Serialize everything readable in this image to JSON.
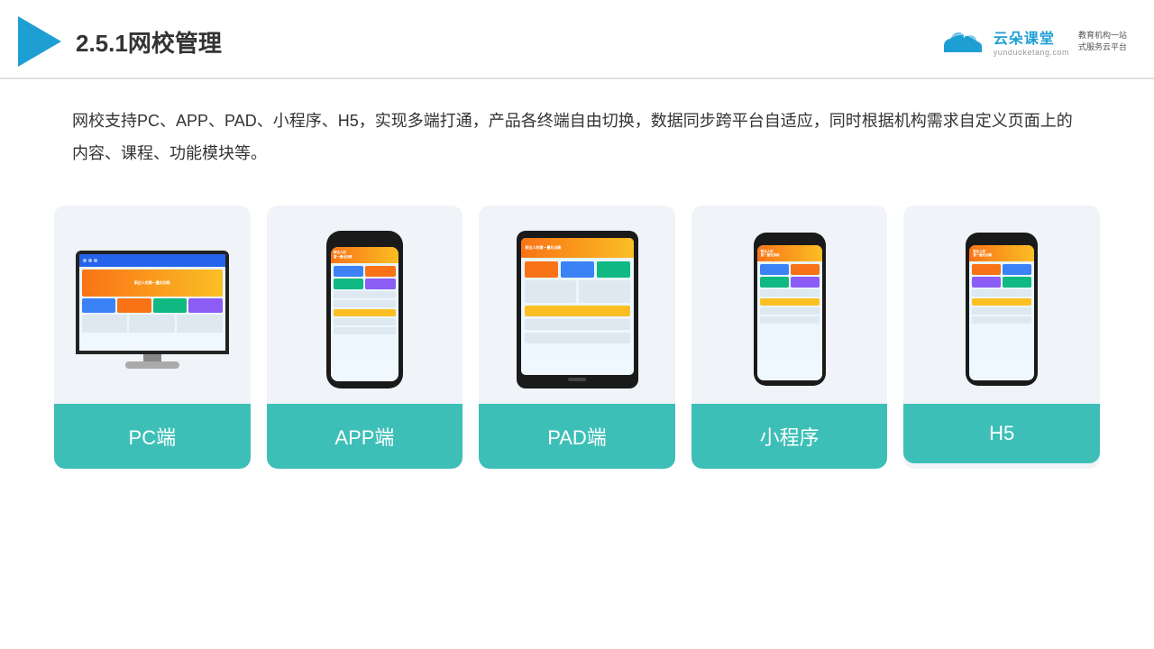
{
  "header": {
    "title": "2.5.1网校管理",
    "brand_name": "云朵课堂",
    "brand_url": "yunduoketang.com",
    "brand_tagline_line1": "教育机构一站",
    "brand_tagline_line2": "式服务云平台"
  },
  "description": {
    "text": "网校支持PC、APP、PAD、小程序、H5，实现多端打通，产品各终端自由切换，数据同步跨平台自适应，同时根据机构需求自定义页面上的内容、课程、功能模块等。"
  },
  "cards": [
    {
      "id": "pc",
      "label": "PC端"
    },
    {
      "id": "app",
      "label": "APP端"
    },
    {
      "id": "pad",
      "label": "PAD端"
    },
    {
      "id": "mini",
      "label": "小程序"
    },
    {
      "id": "h5",
      "label": "H5"
    }
  ]
}
